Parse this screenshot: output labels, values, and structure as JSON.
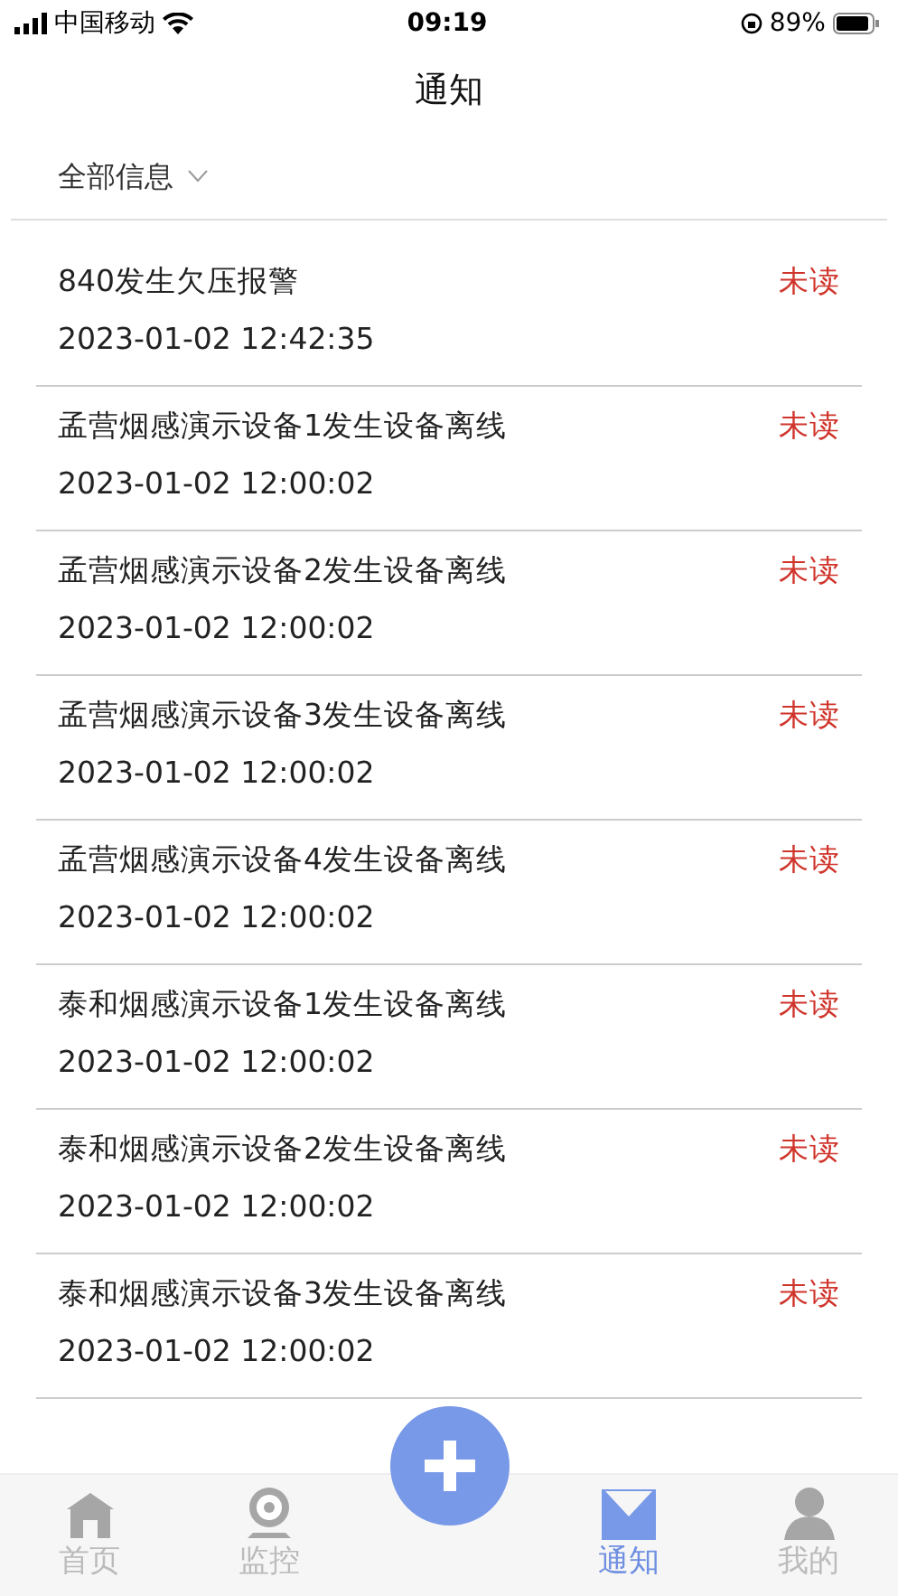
{
  "status_bar": {
    "carrier": "中国移动",
    "time": "09:19",
    "battery": "89%"
  },
  "header": {
    "title": "通知"
  },
  "filter": {
    "label": "全部信息"
  },
  "notifications": [
    {
      "title": "840发生欠压报警",
      "time": "2023-01-02 12:42:35",
      "status": "未读",
      "unread": true
    },
    {
      "title": "孟营烟感演示设备1发生设备离线",
      "time": "2023-01-02 12:00:02",
      "status": "未读",
      "unread": true
    },
    {
      "title": "孟营烟感演示设备2发生设备离线",
      "time": "2023-01-02 12:00:02",
      "status": "未读",
      "unread": true
    },
    {
      "title": "孟营烟感演示设备3发生设备离线",
      "time": "2023-01-02 12:00:02",
      "status": "未读",
      "unread": true
    },
    {
      "title": "孟营烟感演示设备4发生设备离线",
      "time": "2023-01-02 12:00:02",
      "status": "未读",
      "unread": true
    },
    {
      "title": "泰和烟感演示设备1发生设备离线",
      "time": "2023-01-02 12:00:02",
      "status": "未读",
      "unread": true
    },
    {
      "title": "泰和烟感演示设备2发生设备离线",
      "time": "2023-01-02 12:00:02",
      "status": "未读",
      "unread": true
    },
    {
      "title": "泰和烟感演示设备3发生设备离线",
      "time": "2023-01-02 12:00:02",
      "status": "未读",
      "unread": true
    }
  ],
  "tab_bar": [
    {
      "kind": "home",
      "label": "首页",
      "selected": false
    },
    {
      "kind": "camera",
      "label": "监控",
      "selected": false
    },
    {
      "kind": "add"
    },
    {
      "kind": "mail",
      "label": "通知",
      "selected": true
    },
    {
      "kind": "person",
      "label": "我的",
      "selected": false
    }
  ]
}
